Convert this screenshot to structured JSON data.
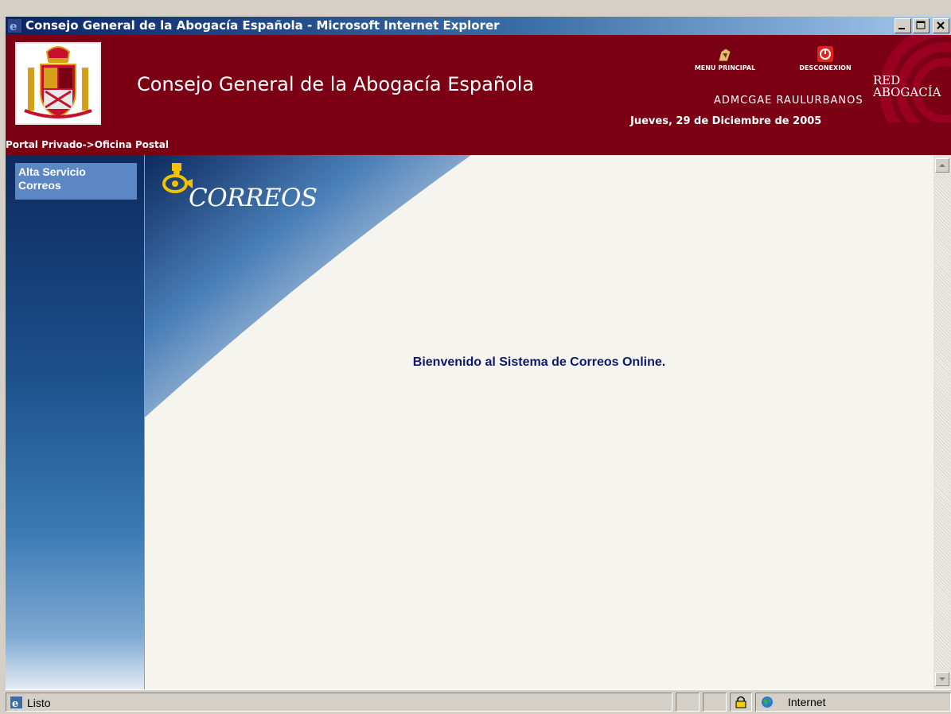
{
  "window": {
    "title": "Consejo General de la Abogacía Española - Microsoft Internet Explorer"
  },
  "header": {
    "site_title": "Consejo General de la Abogacía Española",
    "menu_principal": "MENU PRINCIPAL",
    "desconexion": "DESCONEXION",
    "user": "ADMCGAE RAULURBANOS",
    "date": "Jueves, 29 de Diciembre de 2005",
    "red_logo_line1": "RED",
    "red_logo_line2": "ABOGACÍA",
    "breadcrumb": "Portal Privado->Oficina Postal"
  },
  "sidebar": {
    "items": [
      {
        "label_line1": "Alta Servicio",
        "label_line2": "Correos"
      }
    ]
  },
  "main": {
    "logo_text": "CORREOS",
    "welcome": "Bienvenido al Sistema de Correos Online."
  },
  "statusbar": {
    "status": "Listo",
    "zone": "Internet"
  },
  "colors": {
    "header_bg": "#7b0014",
    "sidebar_link_bg": "#5b87c4",
    "welcome_text": "#0c1a6e"
  }
}
